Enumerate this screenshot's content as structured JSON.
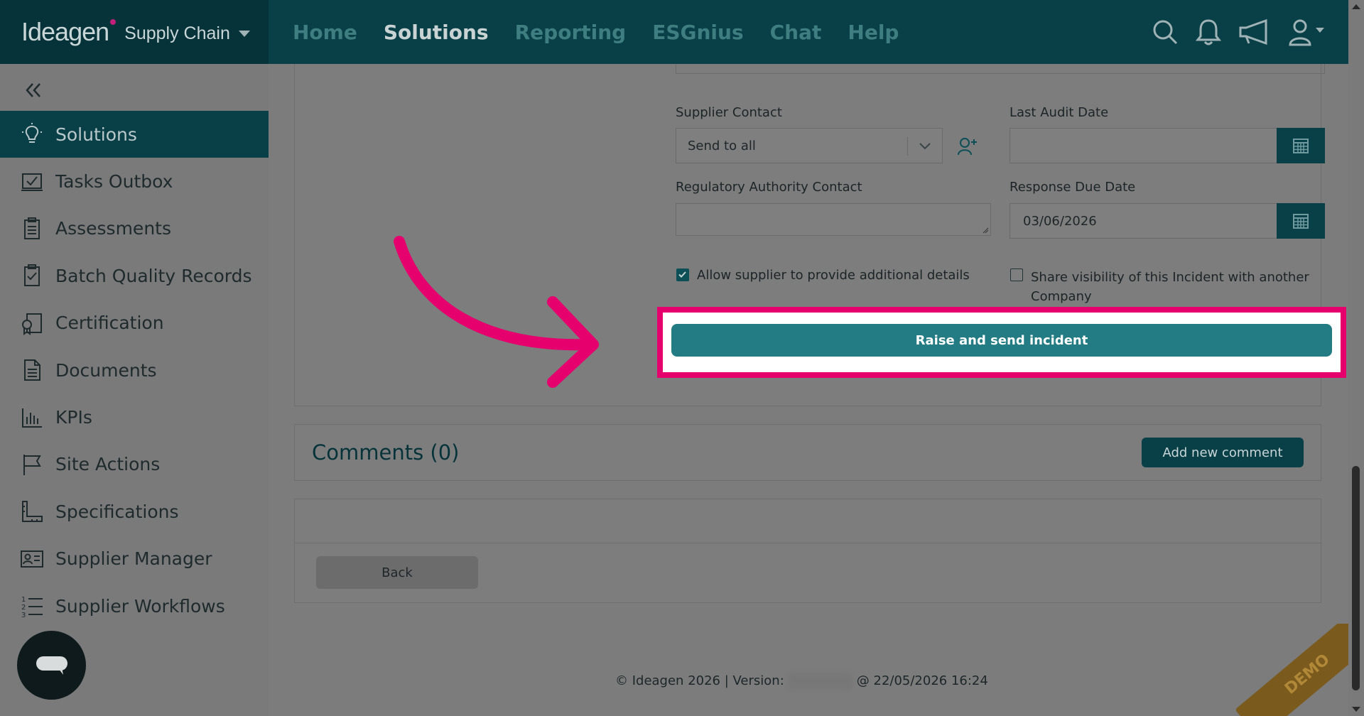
{
  "brand": {
    "logo": "Ideagen",
    "product": "Supply Chain"
  },
  "nav": {
    "items": [
      "Home",
      "Solutions",
      "Reporting",
      "ESGnius",
      "Chat",
      "Help"
    ],
    "active": "Solutions"
  },
  "sidebar": {
    "items": [
      {
        "label": "Solutions",
        "icon": "lightbulb-icon",
        "active": true
      },
      {
        "label": "Tasks Outbox",
        "icon": "tasks-outbox-icon"
      },
      {
        "label": "Assessments",
        "icon": "clipboard-icon"
      },
      {
        "label": "Batch Quality Records",
        "icon": "clipboard-check-icon"
      },
      {
        "label": "Certification",
        "icon": "certificate-icon"
      },
      {
        "label": "Documents",
        "icon": "document-icon"
      },
      {
        "label": "KPIs",
        "icon": "bar-chart-icon"
      },
      {
        "label": "Site Actions",
        "icon": "flag-icon"
      },
      {
        "label": "Specifications",
        "icon": "ruler-icon"
      },
      {
        "label": "Supplier Manager",
        "icon": "id-card-icon"
      },
      {
        "label": "Supplier Workflows",
        "icon": "numbered-list-icon"
      }
    ]
  },
  "form": {
    "supplier_contact_label": "Supplier Contact",
    "supplier_contact_value": "Send to all",
    "last_audit_label": "Last Audit Date",
    "last_audit_value": "",
    "regulatory_label": "Regulatory Authority Contact",
    "regulatory_value": "",
    "response_due_label": "Response Due Date",
    "response_due_value": "03/06/2026",
    "allow_supplier_label": "Allow supplier to provide additional details",
    "allow_supplier_checked": true,
    "share_visibility_label": "Share visibility of this Incident with another Company",
    "share_visibility_checked": false,
    "raise_button": "Raise and send incident"
  },
  "comments": {
    "title": "Comments (0)",
    "add_button": "Add new comment"
  },
  "back_button": "Back",
  "footer": {
    "prefix": "© Ideagen 2026 | Version:",
    "suffix": "@ 22/05/2026 16:24"
  },
  "watermark": "DEMO",
  "colors": {
    "header": "#093f47",
    "accent": "#237c83",
    "highlight": "#e5006e"
  }
}
